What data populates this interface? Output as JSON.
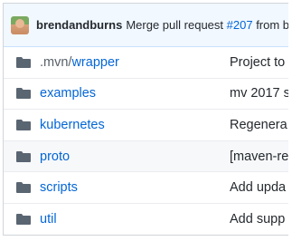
{
  "commit": {
    "author": "brendandburns",
    "message_prefix": "Merge pull request",
    "pr_link": "#207",
    "message_suffix": "from b"
  },
  "files": [
    {
      "name_prefix": ".mvn/",
      "name": "wrapper",
      "message": "Project to",
      "icon": "folder-icon"
    },
    {
      "name_prefix": "",
      "name": "examples",
      "message": "mv 2017 s",
      "icon": "folder-icon"
    },
    {
      "name_prefix": "",
      "name": "kubernetes",
      "message": "Regenera",
      "icon": "folder-icon"
    },
    {
      "name_prefix": "",
      "name": "proto",
      "message": "[maven-re",
      "icon": "folder-icon"
    },
    {
      "name_prefix": "",
      "name": "scripts",
      "message": "Add upda",
      "icon": "folder-icon"
    },
    {
      "name_prefix": "",
      "name": "util",
      "message": "Add supp",
      "icon": "folder-icon"
    }
  ],
  "colors": {
    "link": "#0366d6",
    "folder": "#79b8ff",
    "commit_bar_bg": "#f1f8ff",
    "hover_row_bg": "#f6f8fa"
  }
}
